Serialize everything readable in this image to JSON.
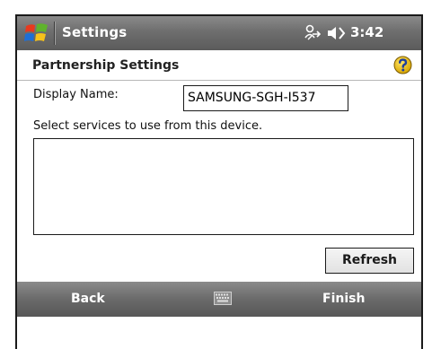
{
  "title_bar": {
    "title": "Settings",
    "time": "3:42",
    "icons": [
      "windows-start-icon",
      "connectivity-icon",
      "speaker-icon"
    ]
  },
  "header": {
    "title": "Partnership Settings",
    "help_icon": "help-icon"
  },
  "form": {
    "display_name_label": "Display Name:",
    "display_name_value": "SAMSUNG-SGH-I537",
    "services_label": "Select services to use from this device.",
    "services": []
  },
  "buttons": {
    "refresh": "Refresh"
  },
  "softkeys": {
    "left": "Back",
    "right": "Finish",
    "center_icon": "keyboard-icon"
  },
  "colors": {
    "title_bar": "#6e6e6e",
    "softkey_bar": "#6a6a6a",
    "title_text": "#ffffff",
    "help_icon": "#f2c200"
  }
}
